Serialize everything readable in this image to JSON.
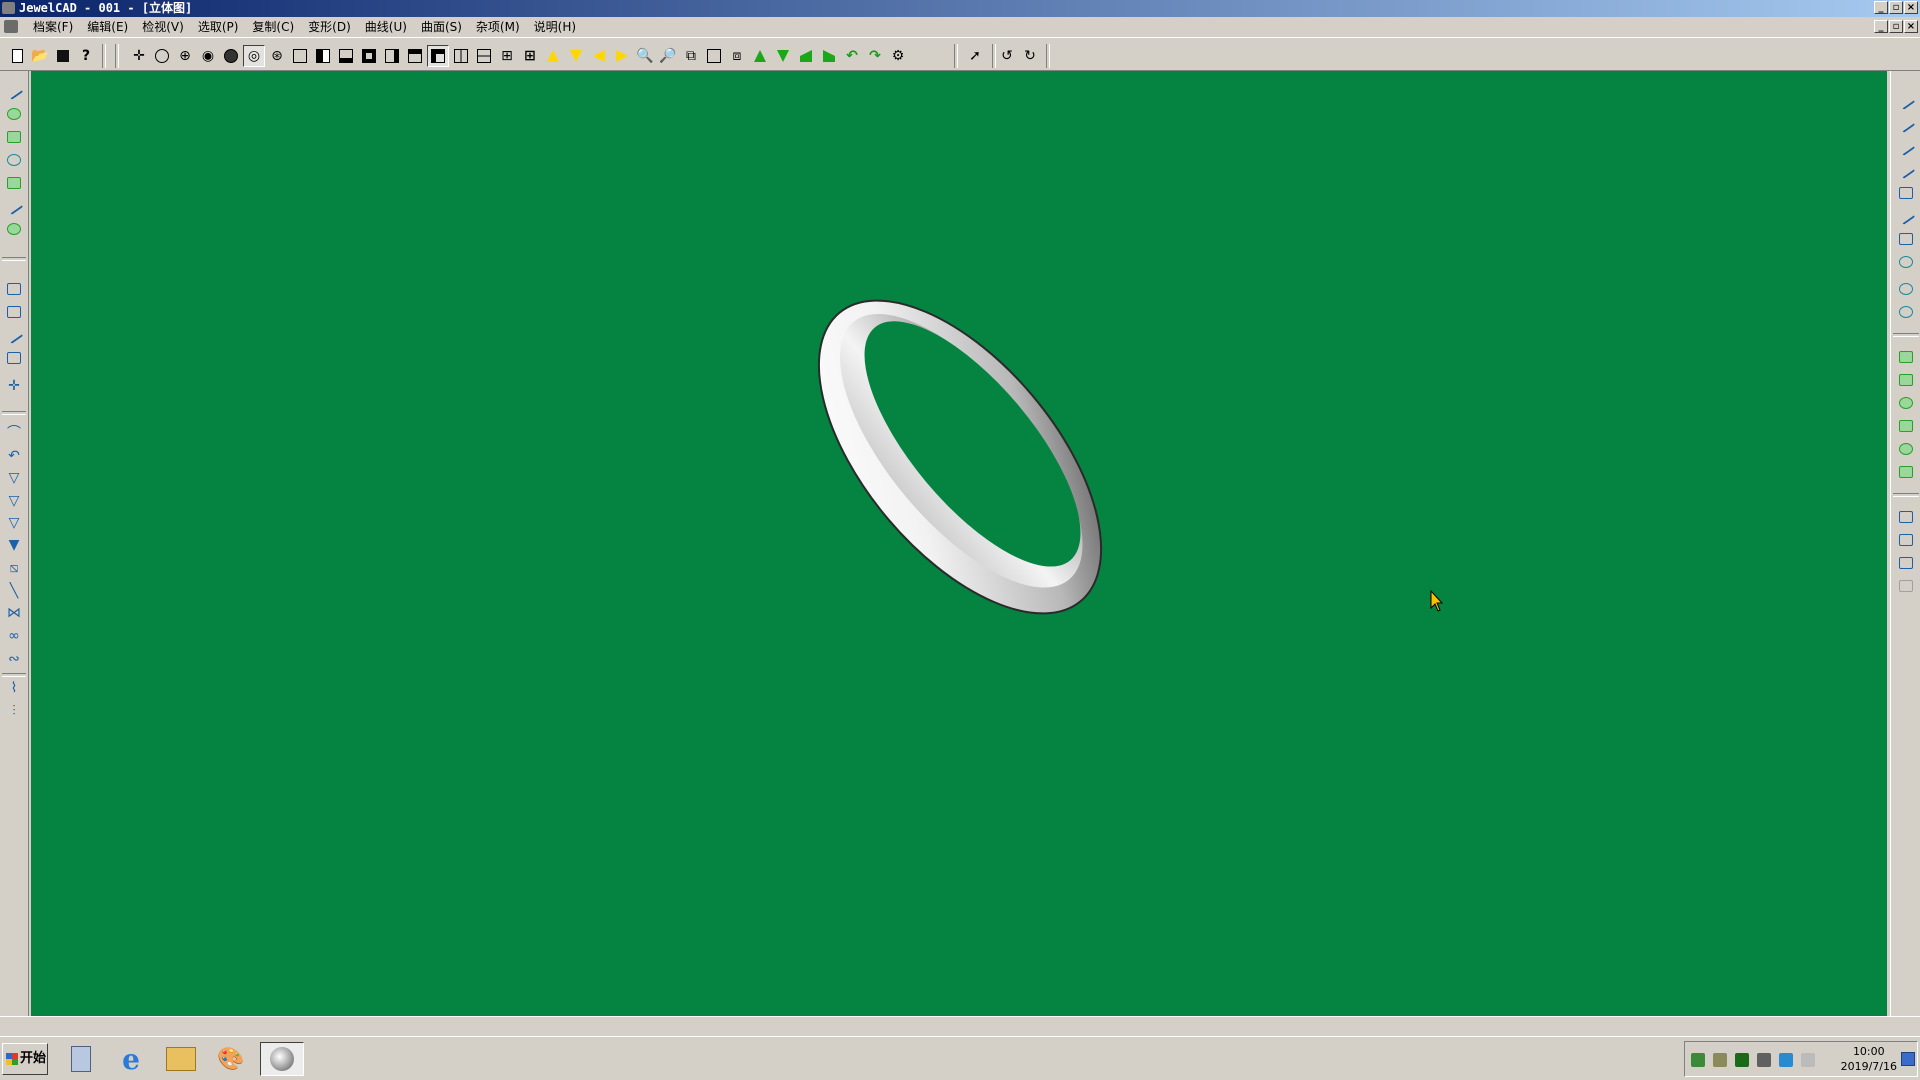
{
  "window": {
    "title": "JewelCAD - 001 - [立体图]"
  },
  "menubar": {
    "items": [
      "档案(F)",
      "编辑(E)",
      "检视(V)",
      "选取(P)",
      "复制(C)",
      "变形(D)",
      "曲线(U)",
      "曲面(S)",
      "杂项(M)",
      "说明(H)"
    ]
  },
  "viewport": {
    "background_color": "#058340",
    "object": "ring"
  },
  "taskbar": {
    "start_label": "开始",
    "clock_time": "10:00",
    "clock_date": "2019/7/16"
  },
  "colors": {
    "viewport": "#058340",
    "titlebar_start": "#0a246a",
    "chrome": "#d4d0c8"
  }
}
